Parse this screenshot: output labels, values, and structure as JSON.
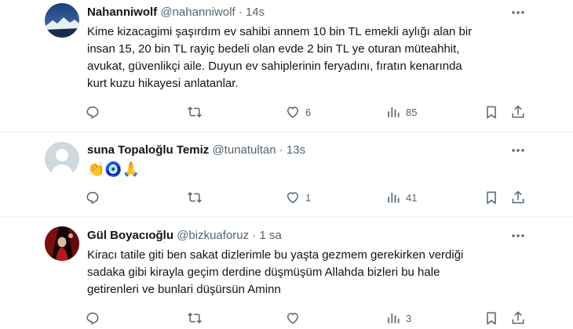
{
  "tweets": [
    {
      "display_name": "Nahanniwolf",
      "handle": "@nahanniwolf",
      "separator": "·",
      "time": "14s",
      "text_lines": [
        "Kime kizacagimi şaşırdım ev sahibi annem 10 bin TL emekli aylığı alan bir",
        "insan 15, 20 bin TL rayiç bedeli olan evde 2 bin TL ye oturan müteahhit,",
        "avukat, güvenlikçi aile. Duyun ev sahiplerinin feryadını, fıratın kenarında",
        "kurt kuzu hikayesi anlatanlar."
      ],
      "replies": "",
      "retweets": "",
      "likes": "6",
      "views": "85"
    },
    {
      "display_name": "suna Topaloğlu Temiz",
      "handle": "@tunatultan",
      "separator": "·",
      "time": "13s",
      "text_lines": [
        "👏🧿🙏"
      ],
      "replies": "",
      "retweets": "",
      "likes": "1",
      "views": "41"
    },
    {
      "display_name": "Gül Boyacıoğlu",
      "handle": "@bizkuaforuz",
      "separator": "·",
      "time": "1 sa",
      "text_lines": [
        "Kiracı tatile giti ben sakat dizlerimle bu yaşta gezmem gerekirken verdiği",
        "sadaka gibi kirayla geçim derdine düşmüşüm Allahda bizleri bu hale",
        "getirenleri ve bunlari düşürsün Aminn"
      ],
      "replies": "",
      "retweets": "",
      "likes": "",
      "views": "3"
    }
  ],
  "colors": {
    "text_primary": "#0f1419",
    "text_secondary": "#536471",
    "divider": "#eff3f4"
  }
}
